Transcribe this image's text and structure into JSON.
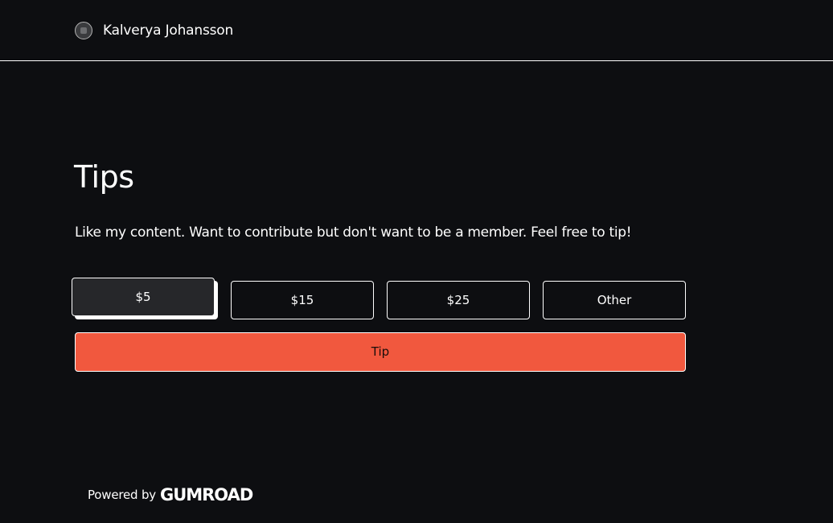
{
  "header": {
    "creator_name": "Kalverya Johansson"
  },
  "main": {
    "title": "Tips",
    "description": "Like my content. Want to contribute but don't want to be a member. Feel free to tip!",
    "amount_options": [
      {
        "label": "$5",
        "selected": true
      },
      {
        "label": "$15",
        "selected": false
      },
      {
        "label": "$25",
        "selected": false
      },
      {
        "label": "Other",
        "selected": false
      }
    ],
    "tip_button_label": "Tip"
  },
  "footer": {
    "powered_by": "Powered by",
    "brand": "GUMROAD"
  },
  "colors": {
    "background": "#0d0e11",
    "accent": "#f1583e",
    "selected_option": "#26272a",
    "border": "#ffffff"
  },
  "icons": {
    "avatar": "creator-avatar"
  }
}
